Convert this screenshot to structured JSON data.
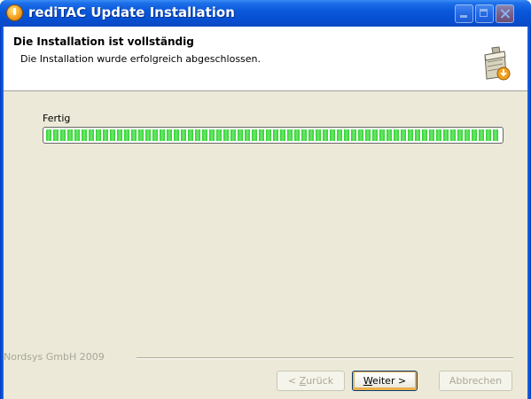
{
  "window": {
    "title": "rediTAC Update Installation",
    "colors": {
      "titlebar": "#0650d3",
      "client": "#ece9d8",
      "progress": "#2ed12e"
    }
  },
  "header": {
    "title": "Die Installation ist vollständig",
    "subtitle": "Die Installation wurde erfolgreich abgeschlossen.",
    "icon": "installer-box-icon"
  },
  "progress": {
    "label": "Fertig",
    "percent": 100
  },
  "footer": {
    "brand": "Nordsys GmbH 2009"
  },
  "buttons": {
    "back": {
      "prefix": "< ",
      "accel": "Z",
      "rest": "urück",
      "enabled": false
    },
    "next": {
      "accel": "W",
      "rest": "eiter >",
      "enabled": true
    },
    "cancel": {
      "label": "Abbrechen",
      "enabled": false
    }
  }
}
